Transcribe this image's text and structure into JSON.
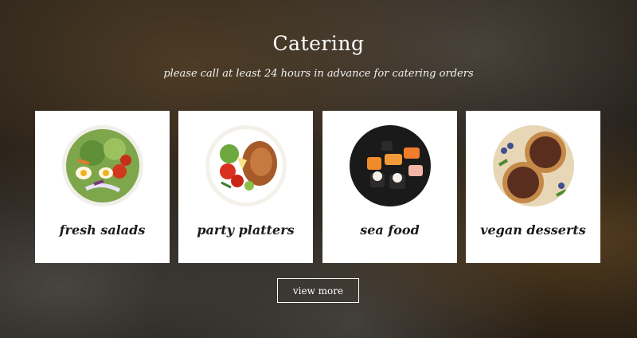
{
  "header": {
    "title": "Catering",
    "subtitle": "please call at least 24 hours in advance for catering orders"
  },
  "cards": [
    {
      "label": "fresh salads",
      "icon": "salad-image"
    },
    {
      "label": "party platters",
      "icon": "platter-image"
    },
    {
      "label": "sea food",
      "icon": "sushi-image"
    },
    {
      "label": "vegan desserts",
      "icon": "tart-image"
    }
  ],
  "actions": {
    "view_more_label": "view more"
  }
}
